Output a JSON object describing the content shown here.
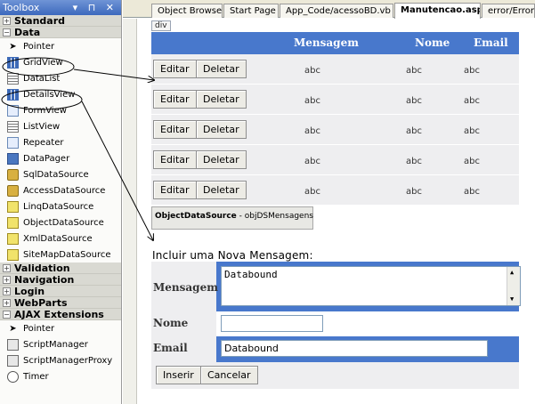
{
  "toolbox": {
    "title": "Toolbox",
    "pin_glyphs": "▾ ⊓ ✕",
    "categories": {
      "standard": "Standard",
      "data": "Data",
      "validation": "Validation",
      "navigation": "Navigation",
      "login": "Login",
      "webparts": "WebParts",
      "ajax": "AJAX Extensions"
    },
    "data_items": [
      "Pointer",
      "GridView",
      "DataList",
      "DetailsView",
      "FormView",
      "ListView",
      "Repeater",
      "DataPager",
      "SqlDataSource",
      "AccessDataSource",
      "LinqDataSource",
      "ObjectDataSource",
      "XmlDataSource",
      "SiteMapDataSource"
    ],
    "ajax_items": [
      "Pointer",
      "ScriptManager",
      "ScriptManagerProxy",
      "Timer"
    ]
  },
  "tabs": [
    "Object Browser",
    "Start Page",
    "App_Code/acessoBD.vb",
    "Manutencao.aspx",
    "error/Error"
  ],
  "active_tab": "Manutencao.aspx",
  "design": {
    "div_tag": "div",
    "grid": {
      "columns": [
        "Mensagem",
        "Nome",
        "Email"
      ],
      "edit_label": "Editar",
      "delete_label": "Deletar",
      "rows": [
        [
          "abc",
          "abc",
          "abc"
        ],
        [
          "abc",
          "abc",
          "abc"
        ],
        [
          "abc",
          "abc",
          "abc"
        ],
        [
          "abc",
          "abc",
          "abc"
        ],
        [
          "abc",
          "abc",
          "abc"
        ]
      ]
    },
    "ods": {
      "type": "ObjectDataSource",
      "id": " - objDSMensagens"
    },
    "insert": {
      "title": "Incluir uma Nova Mensagem:",
      "mensagem_label": "Mensagem",
      "mensagem_value": "Databound",
      "nome_label": "Nome",
      "nome_value": "",
      "email_label": "Email",
      "email_value": "Databound",
      "inserir_label": "Inserir",
      "cancelar_label": "Cancelar"
    }
  },
  "colors": {
    "grid_header": "#4878cc",
    "row_bg": "#eeeef0"
  }
}
